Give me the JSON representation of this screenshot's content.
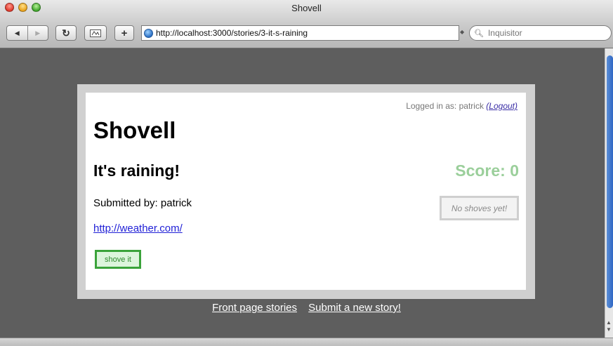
{
  "window": {
    "title": "Shovell"
  },
  "toolbar": {
    "back_icon": "back-arrow-icon",
    "forward_icon": "forward-arrow-icon",
    "reload_icon": "reload-icon",
    "url": "http://localhost:3000/stories/3-it-s-raining",
    "search_placeholder": "Inquisitor"
  },
  "page": {
    "login_prefix": "Logged in as: patrick",
    "logout_label": "(Logout)",
    "site_title": "Shovell",
    "story_title": "It's raining!",
    "score": "Score: 0",
    "submitted_by": "Submitted by: patrick",
    "story_url": "http://weather.com/",
    "shove_button": "shove it",
    "no_shoves": "No shoves yet!"
  },
  "footer": {
    "front_page": "Front page stories",
    "submit_story": "Submit a new story!"
  },
  "colors": {
    "background": "#5e5e5e",
    "score": "#9bcf9b",
    "shove_border": "#3aa33a",
    "link": "#1f1fd6"
  }
}
